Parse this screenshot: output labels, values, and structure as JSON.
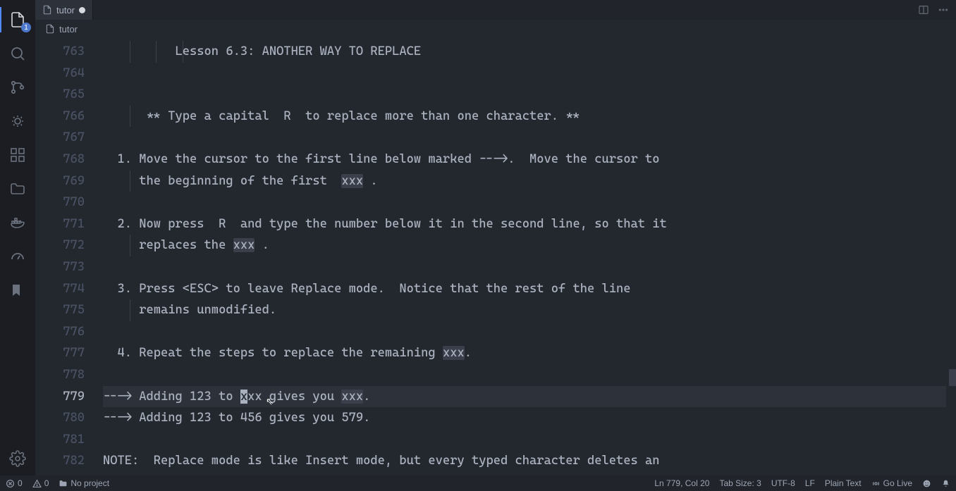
{
  "activity_bar": {
    "explorer_badge": "1"
  },
  "tab": {
    "label": "tutor"
  },
  "breadcrumb": {
    "file": "tutor"
  },
  "editor": {
    "line_start": 763,
    "cursor_line": 779,
    "cursor_col": 20,
    "lines": [
      "          Lesson 6.3: ANOTHER WAY TO REPLACE",
      "",
      "",
      "      ** Type a capital  R  to replace more than one character. **",
      "",
      "  1. Move the cursor to the first line below marked --->.  Move the cursor to",
      "     the beginning of the first  xxx .",
      "",
      "  2. Now press  R  and type the number below it in the second line, so that it",
      "     replaces the xxx .",
      "",
      "  3. Press <ESC> to leave Replace mode.  Notice that the rest of the line",
      "     remains unmodified.",
      "",
      "  4. Repeat the steps to replace the remaining xxx.",
      "",
      "---> Adding 123 to xxx gives you xxx.",
      "---> Adding 123 to 456 gives you 579.",
      "",
      "NOTE:  Replace mode is like Insert mode, but every typed character deletes an"
    ],
    "highlight_token": "xxx"
  },
  "status": {
    "errors": "0",
    "warnings": "0",
    "project": "No project",
    "position": "Ln 779, Col 20",
    "tab_size": "Tab Size: 3",
    "encoding": "UTF-8",
    "eol": "LF",
    "language": "Plain Text",
    "go_live": "Go Live"
  }
}
